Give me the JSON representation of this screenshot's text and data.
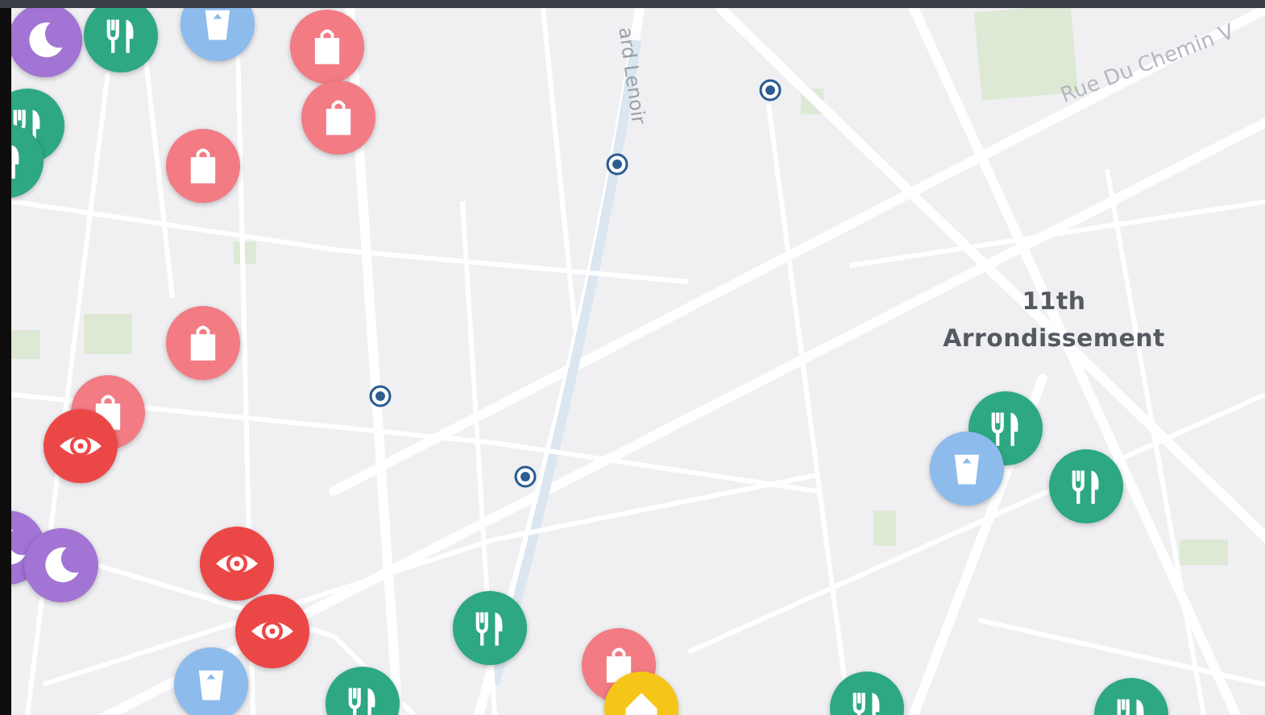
{
  "map": {
    "labels": [
      {
        "kind": "district",
        "text": "11th Arrondissement"
      },
      {
        "kind": "street",
        "text": "Rue Du Chemin V"
      },
      {
        "kind": "boulevard",
        "text": "ard Lenoir"
      }
    ],
    "pins": [
      {
        "kind": "night",
        "color": "#a274d4"
      },
      {
        "kind": "food",
        "color": "#2da883"
      },
      {
        "kind": "drink",
        "color": "#8dbbeb"
      },
      {
        "kind": "shop",
        "color": "#f27b84"
      },
      {
        "kind": "shop",
        "color": "#f27b84"
      },
      {
        "kind": "food",
        "color": "#2da883"
      },
      {
        "kind": "food",
        "color": "#2da883"
      },
      {
        "kind": "shop",
        "color": "#f27b84"
      },
      {
        "kind": "shop",
        "color": "#f27b84"
      },
      {
        "kind": "shop",
        "color": "#f27b84"
      },
      {
        "kind": "sight",
        "color": "#ec4747"
      },
      {
        "kind": "night",
        "color": "#a274d4"
      },
      {
        "kind": "night",
        "color": "#a274d4"
      },
      {
        "kind": "sight",
        "color": "#ec4747"
      },
      {
        "kind": "sight",
        "color": "#ec4747"
      },
      {
        "kind": "drink",
        "color": "#8dbbeb"
      },
      {
        "kind": "food",
        "color": "#2da883"
      },
      {
        "kind": "food",
        "color": "#2da883"
      },
      {
        "kind": "shop",
        "color": "#f27b84"
      },
      {
        "kind": "home",
        "color": "#f5c518"
      },
      {
        "kind": "food",
        "color": "#2da883"
      },
      {
        "kind": "drink",
        "color": "#8dbbeb"
      },
      {
        "kind": "food",
        "color": "#2da883"
      },
      {
        "kind": "food",
        "color": "#2da883"
      },
      {
        "kind": "food",
        "color": "#2da883"
      }
    ]
  }
}
